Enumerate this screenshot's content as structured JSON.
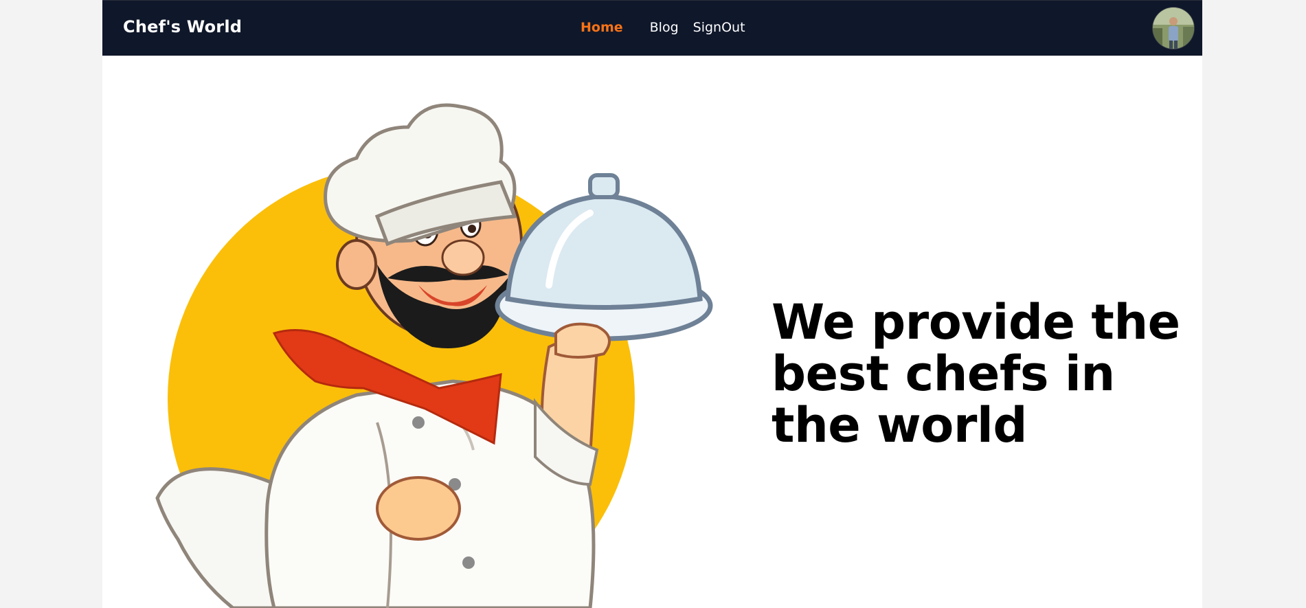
{
  "navbar": {
    "brand": "Chef's World",
    "links": [
      {
        "label": "Home",
        "active": true
      },
      {
        "label": "Blog",
        "active": false
      },
      {
        "label": "SignOut",
        "active": false
      }
    ],
    "avatar_icon": "user-avatar-icon"
  },
  "hero": {
    "title": "We provide the best chefs in the world",
    "illustration_icon": "chef-mascot-icon"
  },
  "colors": {
    "nav_bg": "#0f172a",
    "accent": "#f97316",
    "circle": "#fbbf0a",
    "page_bg": "#ffffff",
    "outer_bg": "#f3f3f3"
  }
}
